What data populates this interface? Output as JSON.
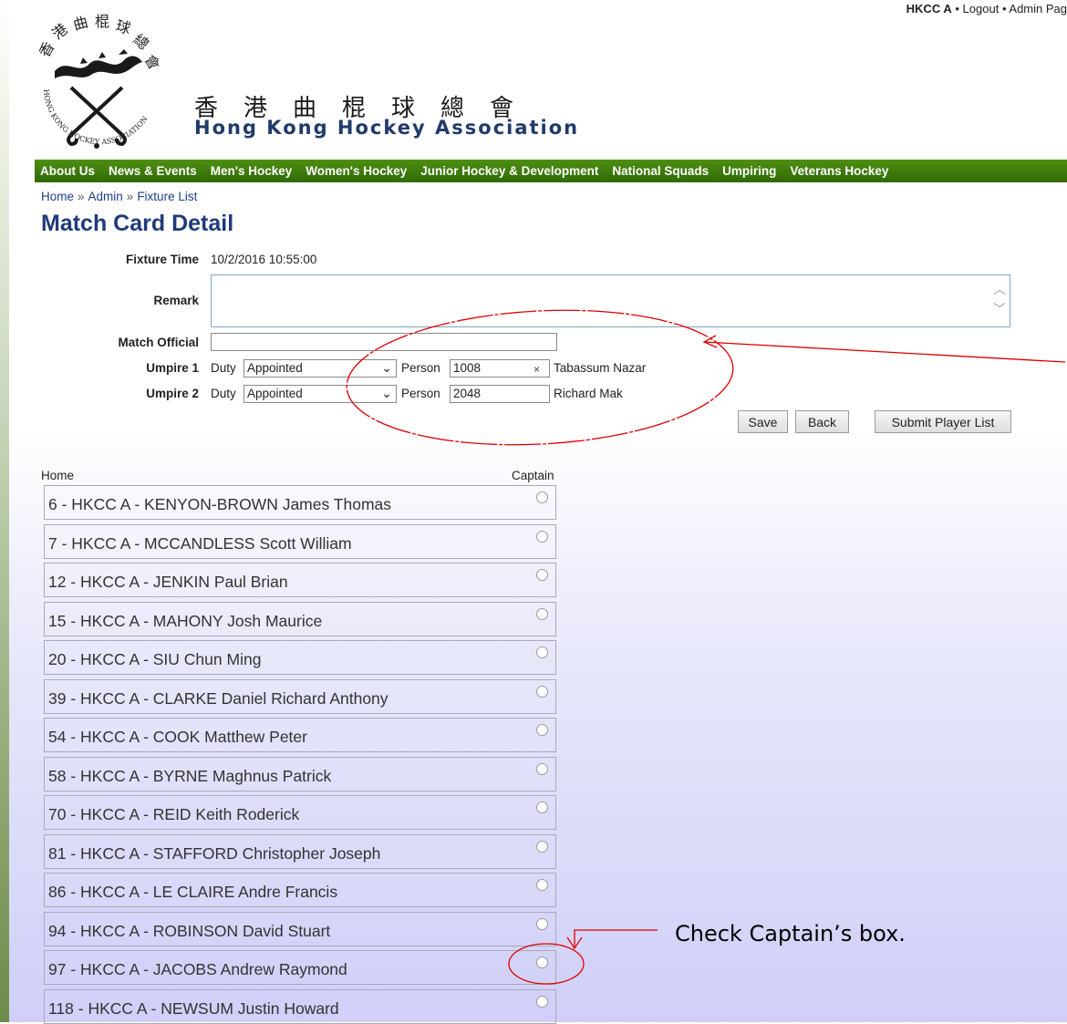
{
  "header": {
    "user": "HKCC A",
    "links": [
      "Logout",
      "Admin Pag"
    ],
    "separator": "•",
    "title_cn": [
      "香",
      "港",
      "曲",
      "棍",
      "球",
      "總",
      "會"
    ],
    "title_en": "Hong Kong Hockey Association",
    "logo_text": "HONG KONG HOCKEY ASSOCIATION"
  },
  "nav": [
    "About Us",
    "News & Events",
    "Men's Hockey",
    "Women's Hockey",
    "Junior Hockey & Development",
    "National Squads",
    "Umpiring",
    "Veterans Hockey"
  ],
  "breadcrumb": [
    "Home",
    "Admin",
    "Fixture List"
  ],
  "breadcrumb_sep": "»",
  "page_title": "Match Card Detail",
  "form": {
    "fixture_time_label": "Fixture Time",
    "fixture_time": "10/2/2016 10:55:00",
    "remark_label": "Remark",
    "remark_value": "",
    "match_official_label": "Match Official",
    "match_official_value": "",
    "umpires": [
      {
        "label": "Umpire 1",
        "duty_label": "Duty",
        "duty": "Appointed",
        "person_label": "Person",
        "person_id": "1008",
        "person_name": "Tabassum Nazar",
        "clear": "×"
      },
      {
        "label": "Umpire 2",
        "duty_label": "Duty",
        "duty": "Appointed",
        "person_label": "Person",
        "person_id": "2048",
        "person_name": "Richard Mak",
        "clear": ""
      }
    ],
    "buttons": {
      "save": "Save",
      "back": "Back",
      "submit": "Submit Player List"
    }
  },
  "players": {
    "home_label": "Home",
    "captain_label": "Captain",
    "list": [
      "6 - HKCC A - KENYON-BROWN James Thomas",
      "7 - HKCC A - MCCANDLESS Scott William",
      "12 - HKCC A - JENKIN Paul Brian",
      "15 - HKCC A - MAHONY Josh Maurice",
      "20 - HKCC A - SIU Chun Ming",
      "39 - HKCC A - CLARKE Daniel Richard Anthony",
      "54 - HKCC A - COOK Matthew Peter",
      "58 - HKCC A - BYRNE Maghnus Patrick",
      "70 - HKCC A - REID Keith Roderick",
      "81 - HKCC A - STAFFORD Christopher Joseph",
      "86 - HKCC A - LE CLAIRE Andre Francis",
      "94 - HKCC A - ROBINSON David Stuart",
      "97 - HKCC A - JACOBS Andrew Raymond",
      "118 - HKCC A - NEWSUM Justin Howard"
    ]
  },
  "annotation": {
    "note": "Check Captain’s box.",
    "color": "#e00000"
  },
  "colors": {
    "nav": "#3d7a0a",
    "title": "#1f3a7c",
    "link": "#1f3f8a"
  }
}
